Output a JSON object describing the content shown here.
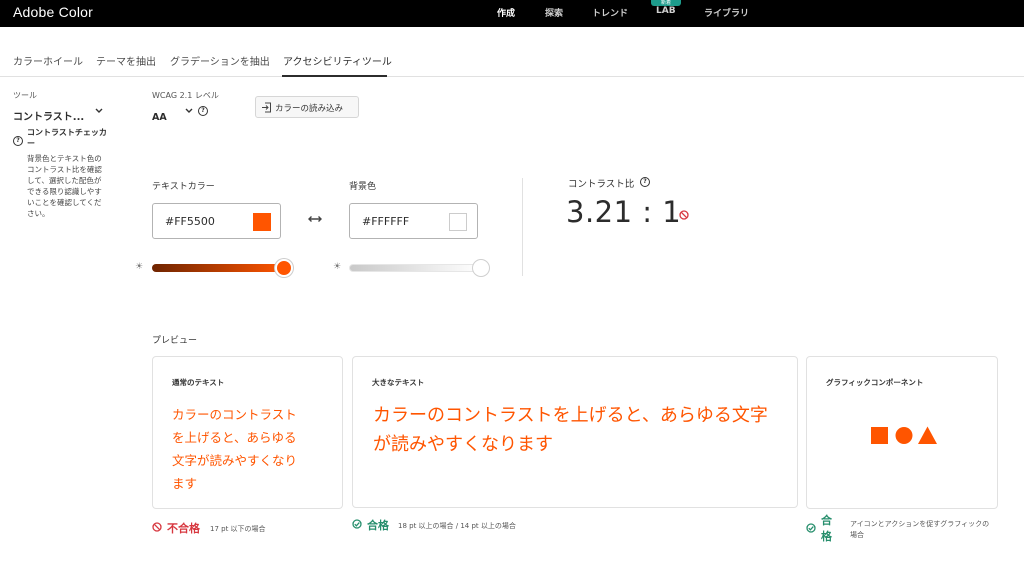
{
  "app": {
    "title": "Adobe Color"
  },
  "nav": {
    "items": [
      {
        "label": "作成",
        "active": true
      },
      {
        "label": "探索",
        "active": false
      },
      {
        "label": "トレンド",
        "active": false
      },
      {
        "label": "LAB",
        "active": false,
        "badge": "新着"
      },
      {
        "label": "ライブラリ",
        "active": false
      }
    ]
  },
  "tabs": [
    {
      "label": "カラーホイール",
      "active": false
    },
    {
      "label": "テーマを抽出",
      "active": false
    },
    {
      "label": "グラデーションを抽出",
      "active": false
    },
    {
      "label": "アクセシビリティツール",
      "active": true
    }
  ],
  "tools": {
    "label": "ツール",
    "selected": "コントラスト...",
    "section_title": "コントラストチェッカー",
    "description": "背景色とテキスト色のコントラスト比を確認して、選択した配色ができる限り認識しやすいことを確認してください。"
  },
  "wcag": {
    "label": "WCAG 2.1 レベル",
    "selected": "AA"
  },
  "load_button": {
    "label": "カラーの読み込み"
  },
  "text_color": {
    "label": "テキストカラー",
    "hex": "#FF5500",
    "color": "#ff5500",
    "slider": 1.0
  },
  "bg_color": {
    "label": "背景色",
    "hex": "#FFFFFF",
    "color": "#ffffff",
    "slider": 1.0
  },
  "contrast": {
    "label": "コントラスト比",
    "value": "3.21 : 1"
  },
  "preview": {
    "label": "プレビュー",
    "normal": {
      "title": "通常のテキスト",
      "sample": "カラーのコントラストを上げると、あらゆる文字が読みやすくなります",
      "result": "不合格",
      "note": "17 pt 以下の場合"
    },
    "large": {
      "title": "大きなテキスト",
      "sample": "カラーのコントラストを上げると、あらゆる文字が読みやすくなります",
      "result": "合格",
      "note": "18 pt 以上の場合 / 14 pt 以上の場合"
    },
    "graphic": {
      "title": "グラフィックコンポーネント",
      "result": "合格",
      "note": "アイコンとアクションを促すグラフィックの場合"
    }
  },
  "colors": {
    "accent": "#ff5500",
    "fail": "#d7373f",
    "pass": "#268e6c"
  }
}
